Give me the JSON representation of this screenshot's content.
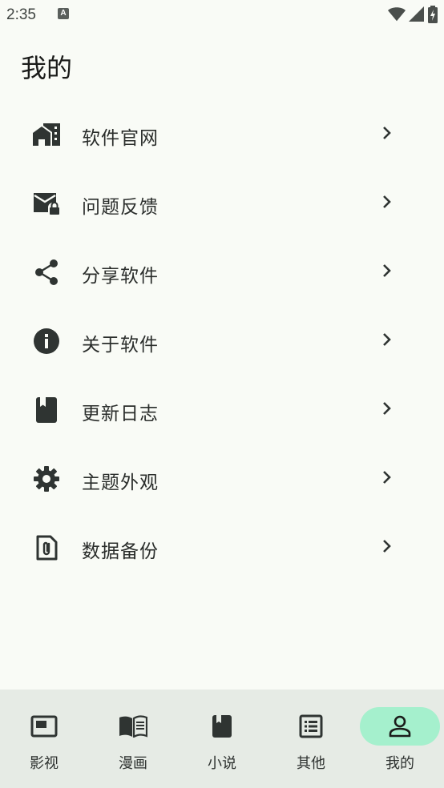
{
  "status_bar": {
    "time": "2:35",
    "notification_letter": "A"
  },
  "page_title": "我的",
  "menu": [
    {
      "label": "软件官网",
      "icon": "home-work-icon"
    },
    {
      "label": "问题反馈",
      "icon": "mail-lock-icon"
    },
    {
      "label": "分享软件",
      "icon": "share-icon"
    },
    {
      "label": "关于软件",
      "icon": "info-icon"
    },
    {
      "label": "更新日志",
      "icon": "book-icon"
    },
    {
      "label": "主题外观",
      "icon": "settings-icon"
    },
    {
      "label": "数据备份",
      "icon": "attachment-file-icon"
    }
  ],
  "bottom_nav": [
    {
      "label": "影视",
      "icon": "movie-icon",
      "active": false
    },
    {
      "label": "漫画",
      "icon": "open-book-icon",
      "active": false
    },
    {
      "label": "小说",
      "icon": "book-icon",
      "active": false
    },
    {
      "label": "其他",
      "icon": "list-icon",
      "active": false
    },
    {
      "label": "我的",
      "icon": "person-icon",
      "active": true
    }
  ],
  "colors": {
    "background": "#f9fbf6",
    "nav_background": "#e6ebe5",
    "active_indicator": "#a5f0cd",
    "icon": "#2f3432"
  }
}
